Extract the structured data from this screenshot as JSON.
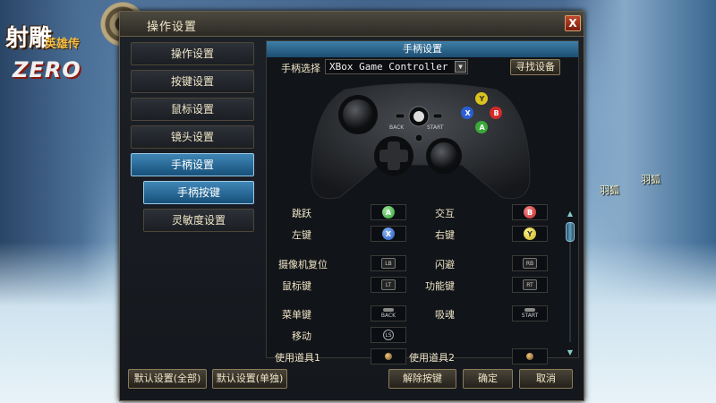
{
  "window": {
    "title": "操作设置",
    "close_label": "X"
  },
  "logo": {
    "line1": "射雕",
    "line2": "英雄传",
    "line3": "ZERO"
  },
  "npcs": [
    "羽狐",
    "羽狐"
  ],
  "sidebar": {
    "items": [
      {
        "label": "操作设置",
        "active": false
      },
      {
        "label": "按键设置",
        "active": false
      },
      {
        "label": "鼠标设置",
        "active": false
      },
      {
        "label": "镜头设置",
        "active": false
      },
      {
        "label": "手柄设置",
        "active": true
      },
      {
        "label": "手柄按键",
        "active": true
      },
      {
        "label": "灵敏度设置",
        "active": false
      }
    ]
  },
  "main": {
    "header": "手柄设置",
    "controller_label": "手柄选择",
    "controller_value": "XBox Game Controller",
    "find_button": "寻找设备",
    "pad_labels": {
      "back": "BACK",
      "start": "START",
      "a": "A",
      "b": "B",
      "x": "X",
      "y": "Y"
    }
  },
  "mappings": [
    {
      "label": "跳跃",
      "key": "A",
      "style": "green"
    },
    {
      "label": "交互",
      "key": "B",
      "style": "red"
    },
    {
      "label": "左键",
      "key": "X",
      "style": "blue"
    },
    {
      "label": "右键",
      "key": "Y",
      "style": "yellow"
    },
    {
      "label": "摄像机复位",
      "key": "LB",
      "style": "trigger"
    },
    {
      "label": "闪避",
      "key": "RB",
      "style": "trigger"
    },
    {
      "label": "鼠标键",
      "key": "LT",
      "style": "trigger"
    },
    {
      "label": "功能键",
      "key": "RT",
      "style": "trigger"
    },
    {
      "label": "菜单键",
      "key": "BACK",
      "style": "pill"
    },
    {
      "label": "吸魂",
      "key": "START",
      "style": "pill"
    },
    {
      "label": "移动",
      "key": "LS",
      "style": "stick"
    },
    {
      "label": "使用道具1",
      "key": "",
      "style": "dot"
    },
    {
      "label": "使用道具2",
      "key": "",
      "style": "dot"
    }
  ],
  "bottom": {
    "default_all": "默认设置(全部)",
    "default_single": "默认设置(单独)",
    "unbind": "解除按键",
    "ok": "确定",
    "cancel": "取消"
  },
  "colors": {
    "accent": "#3f86b6",
    "button_border": "#8a7c5a",
    "text": "#f0e6c8"
  }
}
